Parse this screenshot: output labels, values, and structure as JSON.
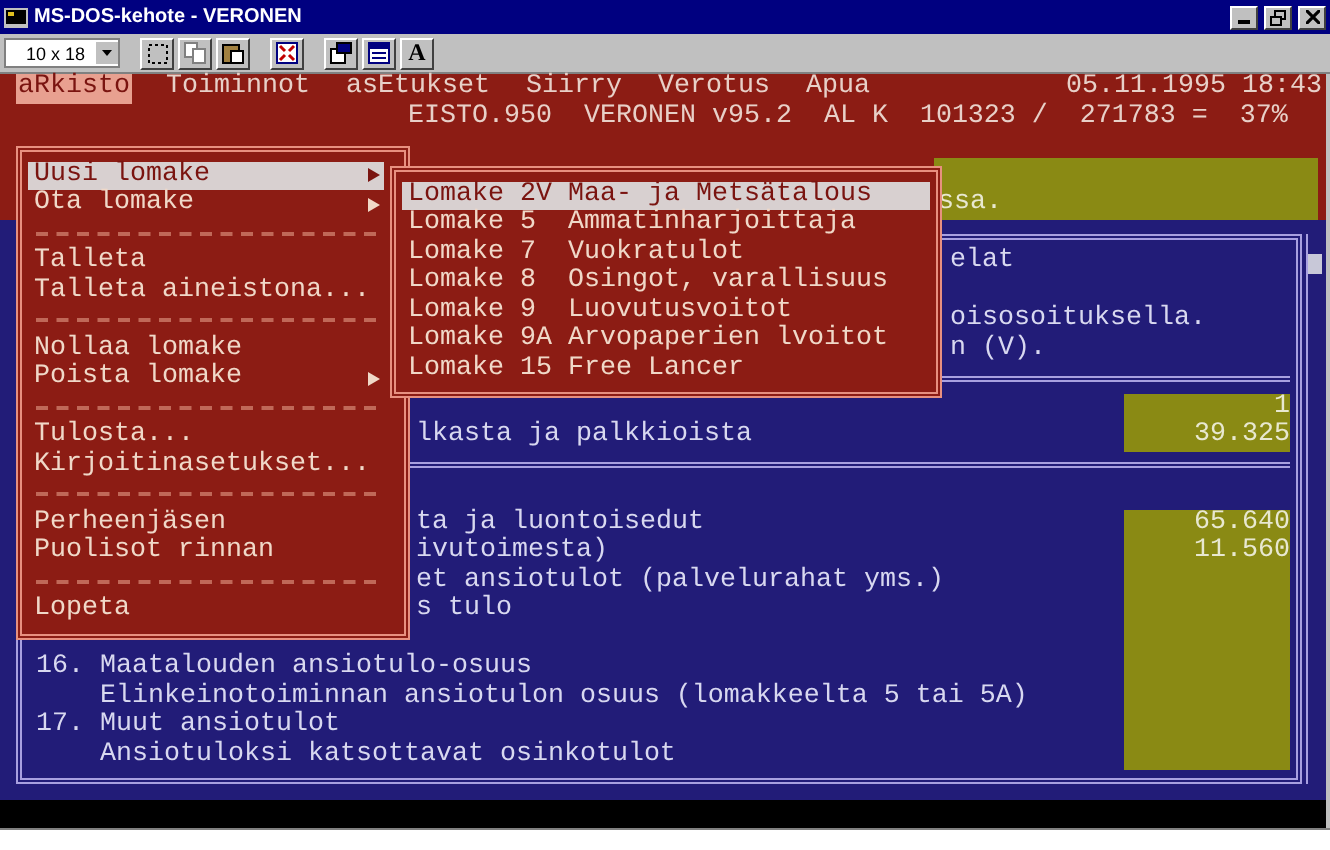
{
  "window": {
    "title": "MS-DOS-kehote - VERONEN"
  },
  "toolbar": {
    "font_size": "10 x 18",
    "font_button": "A"
  },
  "menu_bar": {
    "items": [
      {
        "label": "aRkisto",
        "selected": true
      },
      {
        "label": "Toiminnot",
        "selected": false
      },
      {
        "label": "asEtukset",
        "selected": false
      },
      {
        "label": "Siirry",
        "selected": false
      },
      {
        "label": "Verotus",
        "selected": false
      },
      {
        "label": "Apua",
        "selected": false
      }
    ],
    "datetime": "05.11.1995 18:43"
  },
  "info_line": "EISTO.950  VERONEN v95.2  AL K  101323 /  271783 =  37%",
  "banner": "ssa.",
  "sections": [
    {
      "lines": [
        {
          "text": "elat"
        },
        {
          "text": "oisosoituksella."
        },
        {
          "text": "n (V)."
        }
      ]
    },
    {
      "lines": [
        {
          "value": "1"
        },
        {
          "text": "lkasta ja palkkioista",
          "value": "39.325"
        }
      ]
    },
    {
      "lines": [
        {
          "text": "ta ja luontoisedut",
          "value": "65.640"
        },
        {
          "text": "ivutoimesta)",
          "value": "11.560"
        },
        {
          "text": "et ansiotulot (palvelurahat yms.)"
        },
        {
          "text": "s tulo"
        },
        {
          "text": "16. Maatalouden ansiotulo-osuus"
        },
        {
          "text": "Elinkeinotoiminnan ansiotulon osuus (lomakkeelta 5 tai 5A)"
        },
        {
          "text": "17. Muut ansiotulot"
        },
        {
          "text": "Ansiotuloksi katsottavat osinkotulot"
        }
      ]
    }
  ],
  "main_menu": {
    "items": [
      {
        "kind": "item",
        "label": "Uusi lomake",
        "submenu": true,
        "selected": true
      },
      {
        "kind": "item",
        "label": "Ota lomake",
        "submenu": true,
        "selected": false
      },
      {
        "kind": "separator"
      },
      {
        "kind": "item",
        "label": "Talleta",
        "submenu": false,
        "selected": false
      },
      {
        "kind": "item",
        "label": "Talleta aineistona...",
        "submenu": false,
        "selected": false
      },
      {
        "kind": "separator"
      },
      {
        "kind": "item",
        "label": "Nollaa lomake",
        "submenu": false,
        "selected": false
      },
      {
        "kind": "item",
        "label": "Poista lomake",
        "submenu": true,
        "selected": false
      },
      {
        "kind": "separator"
      },
      {
        "kind": "item",
        "label": "Tulosta...",
        "submenu": false,
        "selected": false
      },
      {
        "kind": "item",
        "label": "Kirjoitinasetukset...",
        "submenu": false,
        "selected": false
      },
      {
        "kind": "separator"
      },
      {
        "kind": "item",
        "label": "Perheenjäsen",
        "submenu": false,
        "selected": false
      },
      {
        "kind": "item",
        "label": "Puolisot rinnan",
        "submenu": false,
        "selected": false
      },
      {
        "kind": "separator"
      },
      {
        "kind": "item",
        "label": "Lopeta",
        "submenu": false,
        "selected": false
      }
    ]
  },
  "submenu": {
    "items": [
      {
        "label": "Lomake 2V Maa- ja Metsätalous",
        "selected": true
      },
      {
        "label": "Lomake 5  Ammatinharjoittaja",
        "selected": false
      },
      {
        "label": "Lomake 7  Vuokratulot",
        "selected": false
      },
      {
        "label": "Lomake 8  Osingot, varallisuus",
        "selected": false
      },
      {
        "label": "Lomake 9  Luovutusvoitot",
        "selected": false
      },
      {
        "label": "Lomake 9A Arvopaperien lvoitot",
        "selected": false
      },
      {
        "label": "Lomake 15 Free Lancer",
        "selected": false
      }
    ]
  }
}
